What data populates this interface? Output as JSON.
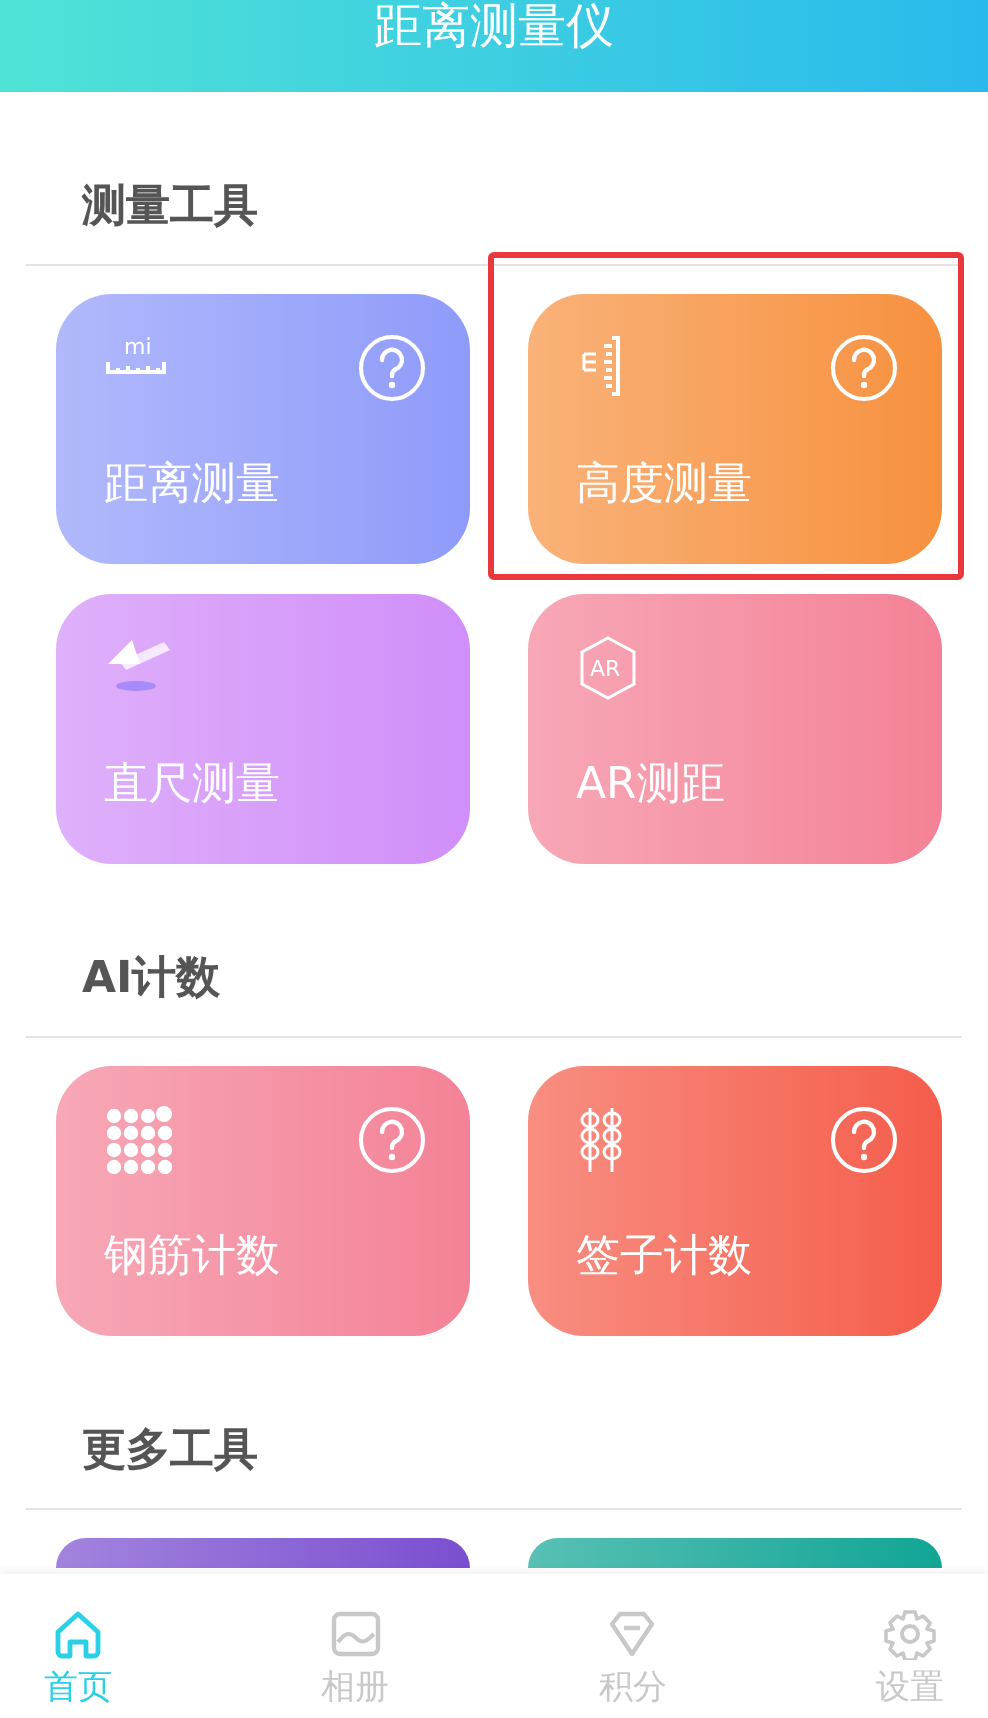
{
  "header": {
    "title": "距离测量仪"
  },
  "sections": [
    {
      "title": "测量工具",
      "cards": [
        {
          "kind": "ruler",
          "icon_text": "mi",
          "label": "距离测量",
          "help": true,
          "highlighted": false,
          "color": "#8f9bfa"
        },
        {
          "kind": "height",
          "label": "高度测量",
          "help": true,
          "highlighted": true,
          "color": "#f7913f"
        },
        {
          "kind": "triangle",
          "label": "直尺测量",
          "help": false,
          "highlighted": false,
          "color": "#d18ef9"
        },
        {
          "kind": "ar",
          "icon_text": "AR",
          "label": "AR测距",
          "help": false,
          "highlighted": false,
          "color": "#f48297"
        }
      ]
    },
    {
      "title": "AI计数",
      "cards": [
        {
          "kind": "dots",
          "label": "钢筋计数",
          "help": true,
          "highlighted": false,
          "color": "#f48297"
        },
        {
          "kind": "skewer",
          "label": "签子计数",
          "help": true,
          "highlighted": false,
          "color": "#f55d4b"
        }
      ]
    },
    {
      "title": "更多工具",
      "cards": [
        {
          "kind": "blank",
          "help": false,
          "highlighted": false,
          "color": "#7a4fd0"
        },
        {
          "kind": "blank",
          "help": false,
          "highlighted": false,
          "color": "#11a595"
        }
      ]
    }
  ],
  "tabs": [
    {
      "kind": "home",
      "label": "首页",
      "selected": true
    },
    {
      "kind": "album",
      "label": "相册",
      "selected": false
    },
    {
      "kind": "points",
      "label": "积分",
      "selected": false
    },
    {
      "kind": "settings",
      "label": "设置",
      "selected": false
    }
  ]
}
